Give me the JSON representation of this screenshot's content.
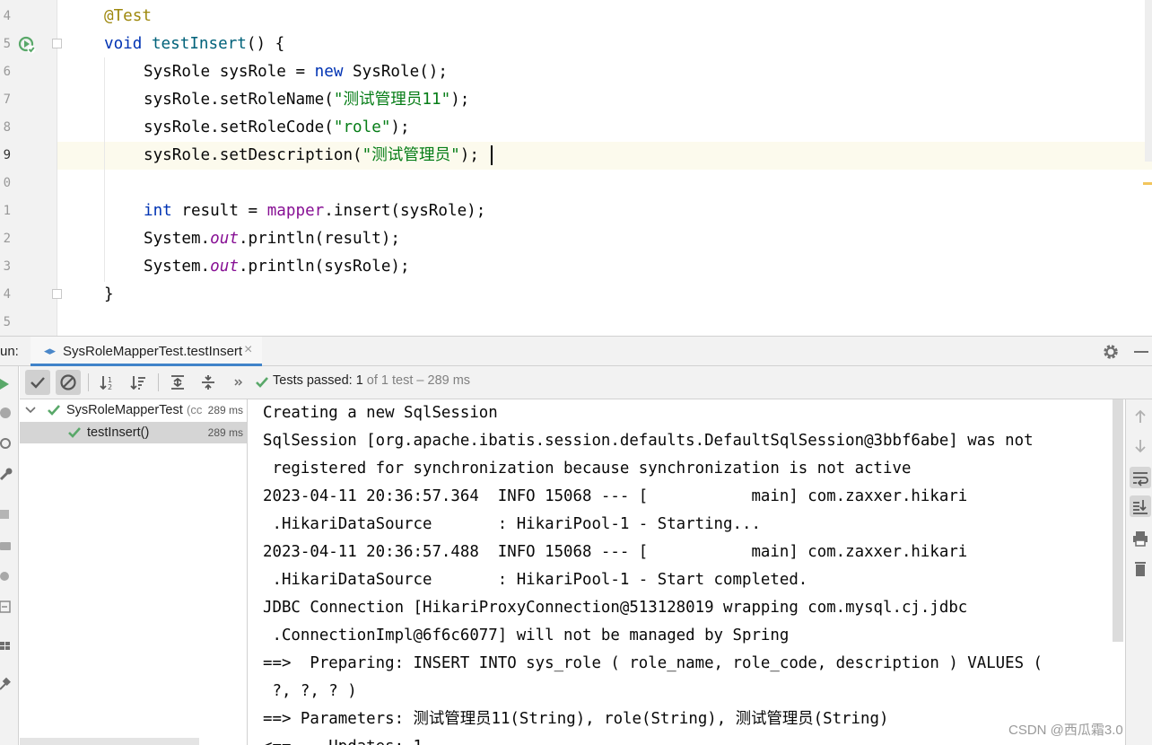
{
  "editor": {
    "line_numbers": [
      "4",
      "5",
      "6",
      "7",
      "8",
      "9",
      "0",
      "1",
      "2",
      "3",
      "4",
      "5"
    ],
    "code": {
      "annotation": "@Test",
      "l1_void": "void",
      "l1_name": "testInsert",
      "l1_rest": "() {",
      "l2_a": "SysRole sysRole = ",
      "l2_new": "new",
      "l2_b": " SysRole();",
      "l3_a": "sysRole.setRoleName(",
      "l3_str": "\"测试管理员11\"",
      "l3_b": ");",
      "l4_a": "sysRole.setRoleCode(",
      "l4_str": "\"role\"",
      "l4_b": ");",
      "l5_a": "sysRole.setDescription(",
      "l5_str": "\"测试管理员\"",
      "l5_b": ");",
      "l6_int": "int",
      "l6_a": " result = ",
      "l6_mapper": "mapper",
      "l6_b": ".insert(sysRole);",
      "l7_a": "System.",
      "l7_out": "out",
      "l7_b": ".println(result);",
      "l8_a": "System.",
      "l8_out": "out",
      "l8_b": ".println(sysRole);",
      "l9": "}"
    }
  },
  "run_panel": {
    "label": "un:",
    "tab_title": "SysRoleMapperTest.testInsert",
    "tab_close": "×"
  },
  "test_status": {
    "prefix": "Tests passed: ",
    "passed": "1",
    "rest": " of 1 test – 289 ms"
  },
  "tree": {
    "suite_name": "SysRoleMapperTest",
    "suite_extra": "(cc",
    "suite_time": "289 ms",
    "test_name": "testInsert()",
    "test_time": "289 ms"
  },
  "console_lines": [
    "Creating a new SqlSession",
    "SqlSession [org.apache.ibatis.session.defaults.DefaultSqlSession@3bbf6abe] was not",
    " registered for synchronization because synchronization is not active",
    "2023-04-11 20:36:57.364  INFO 15068 --- [           main] com.zaxxer.hikari",
    " .HikariDataSource       : HikariPool-1 - Starting...",
    "2023-04-11 20:36:57.488  INFO 15068 --- [           main] com.zaxxer.hikari",
    " .HikariDataSource       : HikariPool-1 - Start completed.",
    "JDBC Connection [HikariProxyConnection@513128019 wrapping com.mysql.cj.jdbc",
    " .ConnectionImpl@6f6c6077] will not be managed by Spring",
    "==>  Preparing: INSERT INTO sys_role ( role_name, role_code, description ) VALUES (",
    " ?, ?, ? )",
    "==> Parameters: 测试管理员11(String), role(String), 测试管理员(String)",
    "<==    Updates: 1"
  ],
  "watermark": "CSDN @西瓜霜3.0",
  "icons": {
    "gutter": "run-test-passed-icon",
    "toolbar": [
      "show-passed-icon",
      "show-ignored-icon",
      "sort-alpha-icon",
      "sort-duration-icon",
      "expand-all-icon",
      "collapse-all-icon",
      "more-icon"
    ],
    "right": [
      "scroll-up-icon",
      "scroll-down-icon",
      "soft-wrap-icon",
      "scroll-to-end-icon",
      "print-icon",
      "clear-icon"
    ]
  },
  "colors": {
    "keyword": "#0033b3",
    "string": "#067d17",
    "field": "#871094",
    "annotation": "#9e880d",
    "pass_green": "#59a869",
    "tab_underline": "#4083c9"
  }
}
